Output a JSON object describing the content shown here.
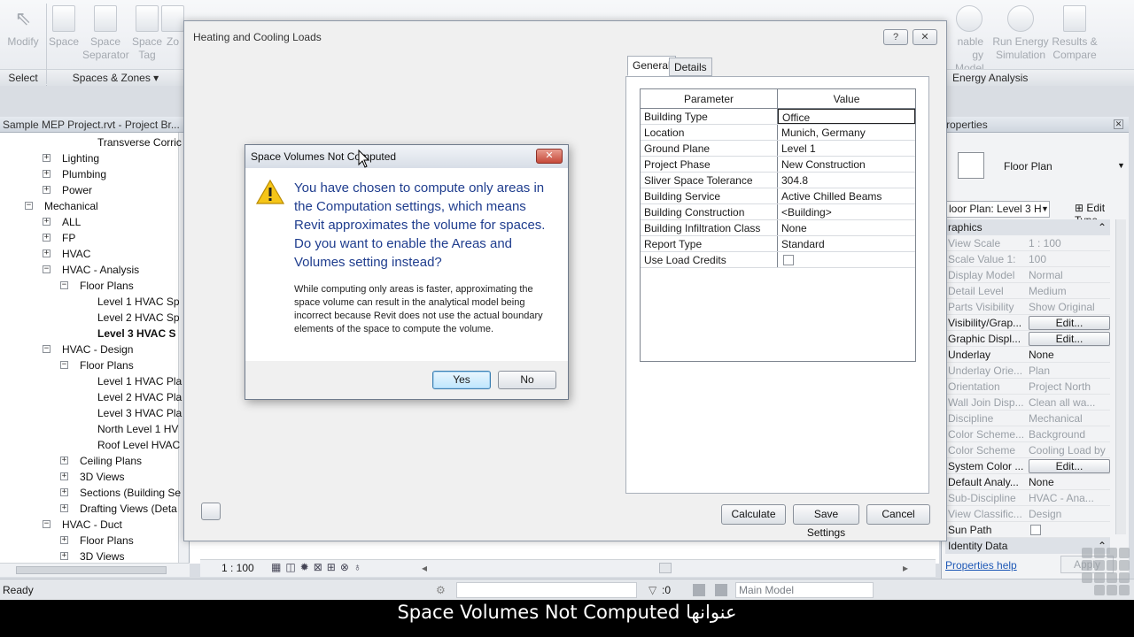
{
  "ribbon": {
    "buttons": [
      "Modify",
      "Space",
      "Space Separator",
      "Space Tag",
      "Zo"
    ],
    "buttons_right": [
      "nable gy Model",
      "Run Energy Simulation",
      "Results & Compare"
    ],
    "panels": {
      "select": "Select",
      "spaces_zones": "Spaces & Zones ▾",
      "energy": "Energy Analysis"
    }
  },
  "browser": {
    "title": "Sample MEP Project.rvt - Project Br...",
    "items": [
      {
        "label": "Transverse Corric",
        "indent": 110,
        "pm": ""
      },
      {
        "label": "Lighting",
        "indent": 70,
        "pm": "+"
      },
      {
        "label": "Plumbing",
        "indent": 70,
        "pm": "+"
      },
      {
        "label": "Power",
        "indent": 70,
        "pm": "+"
      },
      {
        "label": "Mechanical",
        "indent": 50,
        "pm": "-"
      },
      {
        "label": "ALL",
        "indent": 70,
        "pm": "+"
      },
      {
        "label": "FP",
        "indent": 70,
        "pm": "+"
      },
      {
        "label": "HVAC",
        "indent": 70,
        "pm": "+"
      },
      {
        "label": "HVAC - Analysis",
        "indent": 70,
        "pm": "-"
      },
      {
        "label": "Floor Plans",
        "indent": 90,
        "pm": "-"
      },
      {
        "label": "Level 1 HVAC Sp",
        "indent": 110,
        "pm": ""
      },
      {
        "label": "Level 2 HVAC Sp",
        "indent": 110,
        "pm": ""
      },
      {
        "label": "Level 3 HVAC S",
        "indent": 110,
        "pm": "",
        "bold": true
      },
      {
        "label": "HVAC - Design",
        "indent": 70,
        "pm": "-"
      },
      {
        "label": "Floor Plans",
        "indent": 90,
        "pm": "-"
      },
      {
        "label": "Level 1 HVAC Pla",
        "indent": 110,
        "pm": ""
      },
      {
        "label": "Level 2 HVAC Pla",
        "indent": 110,
        "pm": ""
      },
      {
        "label": "Level 3 HVAC Pla",
        "indent": 110,
        "pm": ""
      },
      {
        "label": "North Level 1 HV",
        "indent": 110,
        "pm": ""
      },
      {
        "label": "Roof Level HVAC",
        "indent": 110,
        "pm": ""
      },
      {
        "label": "Ceiling Plans",
        "indent": 90,
        "pm": "+"
      },
      {
        "label": "3D Views",
        "indent": 90,
        "pm": "+"
      },
      {
        "label": "Sections (Building Se",
        "indent": 90,
        "pm": "+"
      },
      {
        "label": "Drafting Views (Deta",
        "indent": 90,
        "pm": "+"
      },
      {
        "label": "HVAC - Duct",
        "indent": 70,
        "pm": "-"
      },
      {
        "label": "Floor Plans",
        "indent": 90,
        "pm": "+"
      },
      {
        "label": "3D Views",
        "indent": 90,
        "pm": "+"
      }
    ]
  },
  "view_bar": {
    "scale": "1 : 100"
  },
  "status": {
    "ready": "Ready",
    "count": ":0",
    "model": "Main Model"
  },
  "properties": {
    "title": "roperties",
    "type_name": "Floor Plan",
    "filter": "loor Plan: Level 3 H",
    "edit_type": "Edit Type",
    "category_graphics": "raphics",
    "rows": [
      {
        "name": "View Scale",
        "value": "1 : 100",
        "dim": true
      },
      {
        "name": "Scale Value    1:",
        "value": "100",
        "dim": true
      },
      {
        "name": "Display Model",
        "value": "Normal",
        "dim": true
      },
      {
        "name": "Detail Level",
        "value": "Medium",
        "dim": true
      },
      {
        "name": "Parts Visibility",
        "value": "Show Original",
        "dim": true
      },
      {
        "name": "Visibility/Grap...",
        "value": "Edit...",
        "button": true
      },
      {
        "name": "Graphic Displ...",
        "value": "Edit...",
        "button": true
      },
      {
        "name": "Underlay",
        "value": "None"
      },
      {
        "name": "Underlay Orie...",
        "value": "Plan",
        "dim": true
      },
      {
        "name": "Orientation",
        "value": "Project North",
        "dim": true
      },
      {
        "name": "Wall Join Disp...",
        "value": "Clean all wa...",
        "dim": true
      },
      {
        "name": "Discipline",
        "value": "Mechanical",
        "dim": true
      },
      {
        "name": "Color Scheme...",
        "value": "Background",
        "dim": true
      },
      {
        "name": "Color Scheme",
        "value": "Cooling Load by",
        "dim": true
      },
      {
        "name": "System Color ...",
        "value": "Edit...",
        "button": true
      },
      {
        "name": "Default Analy...",
        "value": "None"
      },
      {
        "name": "Sub-Discipline",
        "value": "HVAC - Ana...",
        "dim": true
      },
      {
        "name": "View Classific...",
        "value": "Design",
        "dim": true
      },
      {
        "name": "Sun Path",
        "value": "",
        "checkbox": true
      }
    ],
    "category_identity": "Identity Data",
    "help": "Properties help",
    "apply": "Apply"
  },
  "hcl_dialog": {
    "title": "Heating and Cooling Loads",
    "help_btn": "?",
    "close_btn": "✕",
    "tabs": [
      "General",
      "Details"
    ],
    "grid": {
      "headers": [
        "Parameter",
        "Value"
      ],
      "rows": [
        {
          "param": "Building Type",
          "value": "Office"
        },
        {
          "param": "Location",
          "value": "Munich, Germany"
        },
        {
          "param": "Ground Plane",
          "value": "Level 1"
        },
        {
          "param": "Project Phase",
          "value": "New Construction"
        },
        {
          "param": "Sliver Space Tolerance",
          "value": "304.8"
        },
        {
          "param": "Building Service",
          "value": "Active Chilled Beams"
        },
        {
          "param": "Building Construction",
          "value": "<Building>"
        },
        {
          "param": "Building Infiltration Class",
          "value": "None"
        },
        {
          "param": "Report Type",
          "value": "Standard"
        },
        {
          "param": "Use Load Credits",
          "value": ""
        }
      ]
    },
    "buttons": {
      "calculate": "Calculate",
      "save_settings": "Save Settings",
      "cancel": "Cancel"
    }
  },
  "alert": {
    "title": "Space Volumes Not Computed",
    "close": "✕",
    "main_instruction": "You have chosen to compute only areas in the Computation settings, which means Revit approximates the volume for spaces. Do you want to enable the Areas and Volumes setting instead?",
    "content": "While computing only areas is faster, approximating the space volume can result in the analytical model being incorrect because Revit does not use the actual boundary elements of the space to compute the volume.",
    "yes": "Yes",
    "no": "No"
  },
  "caption": "Space Volumes Not Computed عنوانها"
}
